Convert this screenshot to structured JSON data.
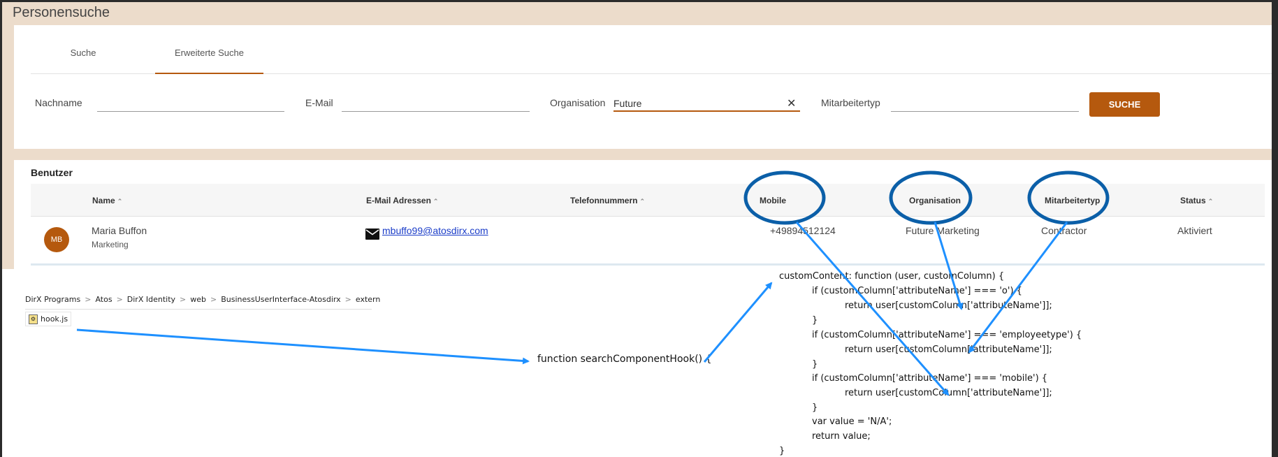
{
  "app": {
    "title": "Personensuche",
    "tabs": [
      "Suche",
      "Erweiterte Suche"
    ],
    "filters": {
      "nachname_label": "Nachname",
      "nachname_value": "",
      "email_label": "E-Mail",
      "email_value": "",
      "organisation_label": "Organisation",
      "organisation_value": "Future",
      "mitarbeitertyp_label": "Mitarbeitertyp",
      "mitarbeitertyp_value": "",
      "clear_glyph": "✕",
      "search_button": "SUCHE"
    },
    "results": {
      "title": "Benutzer",
      "columns": [
        "Name",
        "E-Mail Adressen",
        "Telefonnummern",
        "Mobile",
        "Organisation",
        "Mitarbeitertyp",
        "Status"
      ],
      "sort_glyph": "⌃",
      "rows": [
        {
          "initials": "MB",
          "name": "Maria Buffon",
          "department": "Marketing",
          "email": "mbuffo99@atosdirx.com",
          "phone": "",
          "mobile": "+49894512124",
          "organisation": "Future Marketing",
          "employee_type": "Contractor",
          "status": "Aktiviert"
        }
      ]
    }
  },
  "explorer": {
    "breadcrumb": [
      "DirX Programs",
      "Atos",
      "DirX Identity",
      "web",
      "BusinessUserInterface-Atosdirx",
      "extern"
    ],
    "separator": ">",
    "file": "hook.js"
  },
  "code": {
    "hook_function": "function searchComponentHook() {",
    "lines": [
      "customContent: function (user, customColumn) {",
      "if (customColumn['attributeName'] === 'o') {",
      "return user[customColumn['attributeName']];",
      "}",
      "if (customColumn['attributeName'] === 'employeetype') {",
      "return user[customColumn['attributeName']];",
      "}",
      "if (customColumn['attributeName'] === 'mobile') {",
      "return user[customColumn['attributeName']];",
      "}",
      "var value = 'N/A';",
      "return value;",
      "}"
    ]
  },
  "colors": {
    "accent": "#b5590e",
    "annotation_circle": "#0b5fa8",
    "annotation_arrow": "#1e90ff"
  }
}
